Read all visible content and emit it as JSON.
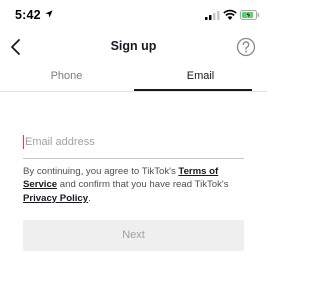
{
  "status_bar": {
    "time": "5:42",
    "icons": [
      "location-arrow-icon",
      "cellular-signal-icon",
      "wifi-icon",
      "battery-charging-icon"
    ]
  },
  "nav": {
    "title": "Sign up",
    "back_icon": "chevron-left-icon",
    "help_icon": "question-circle-icon"
  },
  "tabs": [
    {
      "label": "Phone",
      "selected": false
    },
    {
      "label": "Email",
      "selected": true
    }
  ],
  "email_field": {
    "placeholder": "Email address",
    "value": ""
  },
  "terms": {
    "prefix": "By continuing, you agree to TikTok's ",
    "terms_link": "Terms of Service",
    "middle": " and confirm that you have read TikTok's ",
    "privacy_link": "Privacy Policy",
    "suffix": "."
  },
  "next_button": {
    "label": "Next",
    "enabled": false
  },
  "colors": {
    "accent": "#fe2c55",
    "text_primary": "#161823",
    "text_secondary": "#7a7b80",
    "battery": "#4cd964",
    "button_disabled_bg": "#efeff0"
  }
}
